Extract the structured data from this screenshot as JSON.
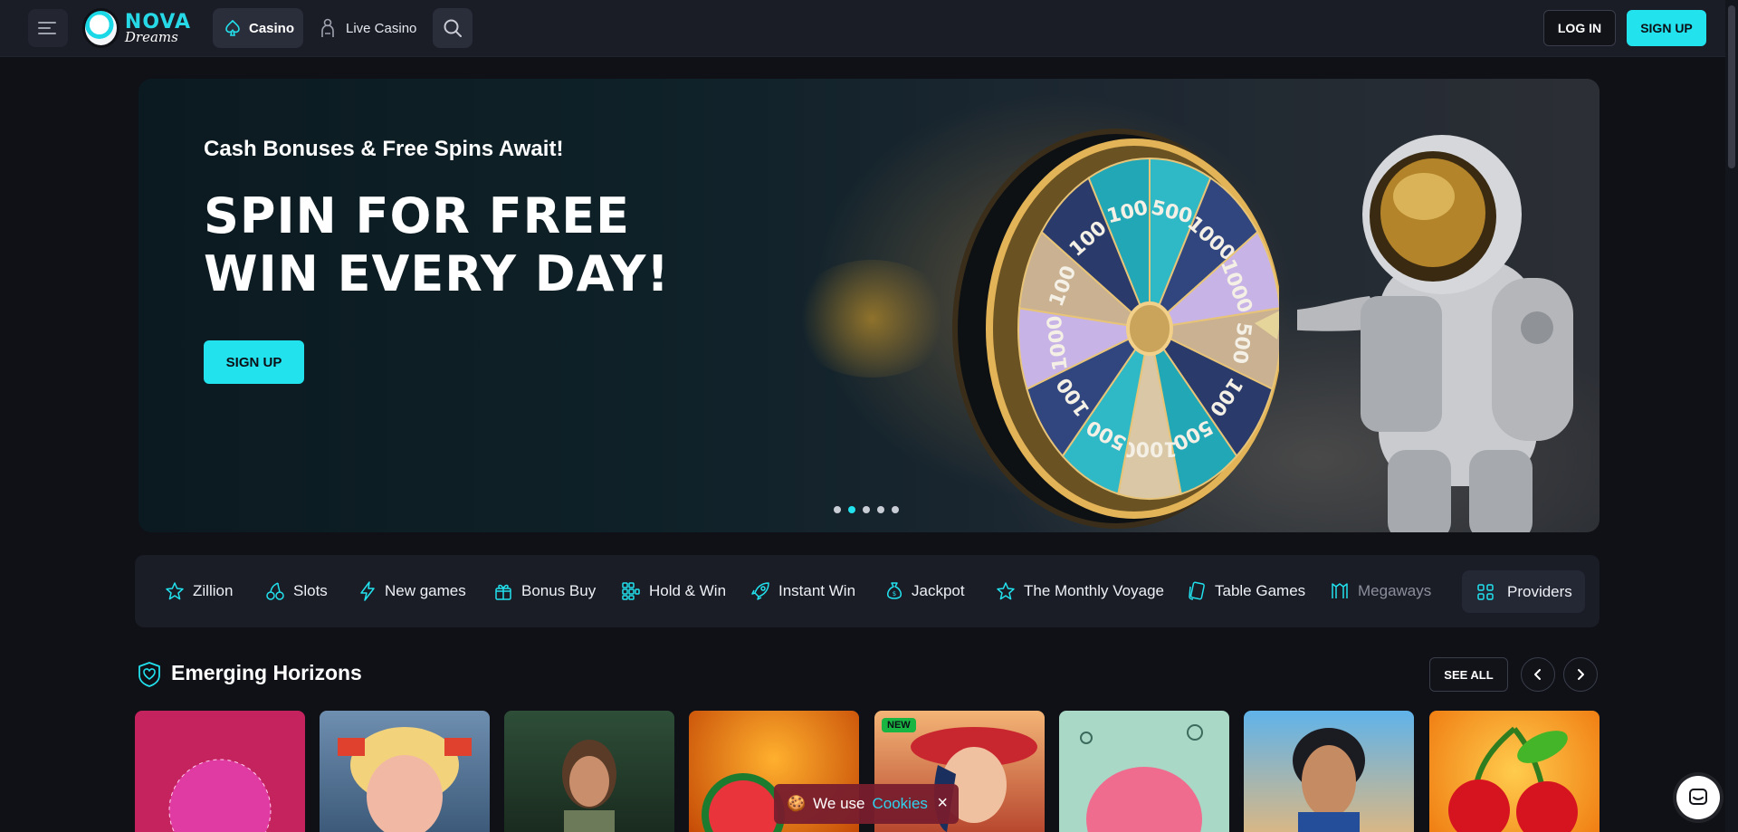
{
  "header": {
    "logo": {
      "top": "NOVA",
      "bottom": "Dreams"
    },
    "nav": [
      {
        "label": "Casino",
        "icon": "spade-icon",
        "active": true
      },
      {
        "label": "Live Casino",
        "icon": "dealer-icon",
        "active": false
      }
    ],
    "login_label": "LOG IN",
    "signup_label": "SIGN UP"
  },
  "hero": {
    "subtitle": "Cash Bonuses & Free Spins Await!",
    "title_line1": "SPIN FOR FREE",
    "title_line2": "WIN EVERY DAY!",
    "cta_label": "SIGN UP",
    "wheel_values": [
      "500",
      "1000",
      "1000",
      "500",
      "100",
      "500",
      "1000",
      "500",
      "100",
      "1000",
      "100",
      "100",
      "100"
    ],
    "slide_count": 5,
    "active_slide": 2
  },
  "categories": [
    {
      "label": "Zillion",
      "icon": "star-icon"
    },
    {
      "label": "Slots",
      "icon": "cherry-icon"
    },
    {
      "label": "New games",
      "icon": "lightning-icon"
    },
    {
      "label": "Bonus Buy",
      "icon": "gift-icon"
    },
    {
      "label": "Hold & Win",
      "icon": "grid-dots-icon"
    },
    {
      "label": "Instant Win",
      "icon": "rocket-icon"
    },
    {
      "label": "Jackpot",
      "icon": "money-bag-icon"
    },
    {
      "label": "The Monthly Voyage",
      "icon": "star-icon"
    },
    {
      "label": "Table Games",
      "icon": "cards-icon"
    },
    {
      "label": "Megaways",
      "icon": "megaways-icon"
    }
  ],
  "providers_label": "Providers",
  "section": {
    "title": "Emerging Horizons",
    "see_all_label": "SEE ALL"
  },
  "tiles": [
    {
      "badge": ""
    },
    {
      "badge": ""
    },
    {
      "badge": ""
    },
    {
      "badge": ""
    },
    {
      "badge": "NEW"
    },
    {
      "badge": ""
    },
    {
      "badge": ""
    },
    {
      "badge": ""
    }
  ],
  "cookie": {
    "prefix": "We use",
    "link": "Cookies",
    "close": "×"
  },
  "colors": {
    "accent": "#22e2ee",
    "background": "#0f1117",
    "bar": "#1a1c26",
    "new_badge": "#18b543"
  }
}
